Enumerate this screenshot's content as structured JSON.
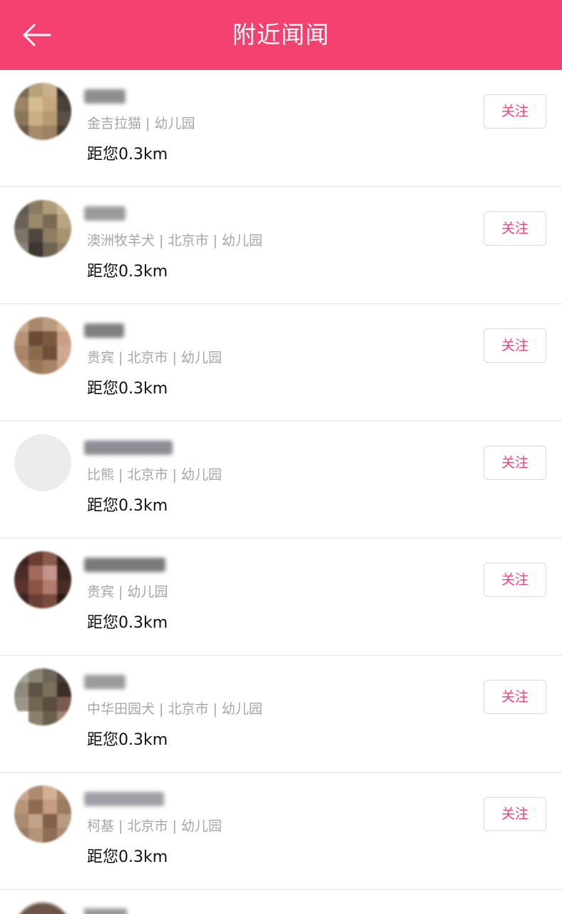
{
  "header": {
    "title": "附近闻闻",
    "back_icon": "arrow-left-icon"
  },
  "colors": {
    "header_bg": "#f4416f",
    "follow_text": "#e8457a",
    "tag_text": "#a5a5ab"
  },
  "users": [
    {
      "tags": "金吉拉猫 | 幼儿园",
      "distance": "距您0.3km",
      "follow_label": "关注"
    },
    {
      "tags": "澳洲牧羊犬 | 北京市 | 幼儿园",
      "distance": "距您0.3km",
      "follow_label": "关注"
    },
    {
      "tags": "贵宾 | 北京市 | 幼儿园",
      "distance": "距您0.3km",
      "follow_label": "关注"
    },
    {
      "tags": "比熊 | 北京市 | 幼儿园",
      "distance": "距您0.3km",
      "follow_label": "关注"
    },
    {
      "tags": "贵宾 | 幼儿园",
      "distance": "距您0.3km",
      "follow_label": "关注"
    },
    {
      "tags": "中华田园犬 | 北京市 | 幼儿园",
      "distance": "距您0.3km",
      "follow_label": "关注"
    },
    {
      "tags": "柯基 | 北京市 | 幼儿园",
      "distance": "距您0.3km",
      "follow_label": "关注"
    }
  ]
}
